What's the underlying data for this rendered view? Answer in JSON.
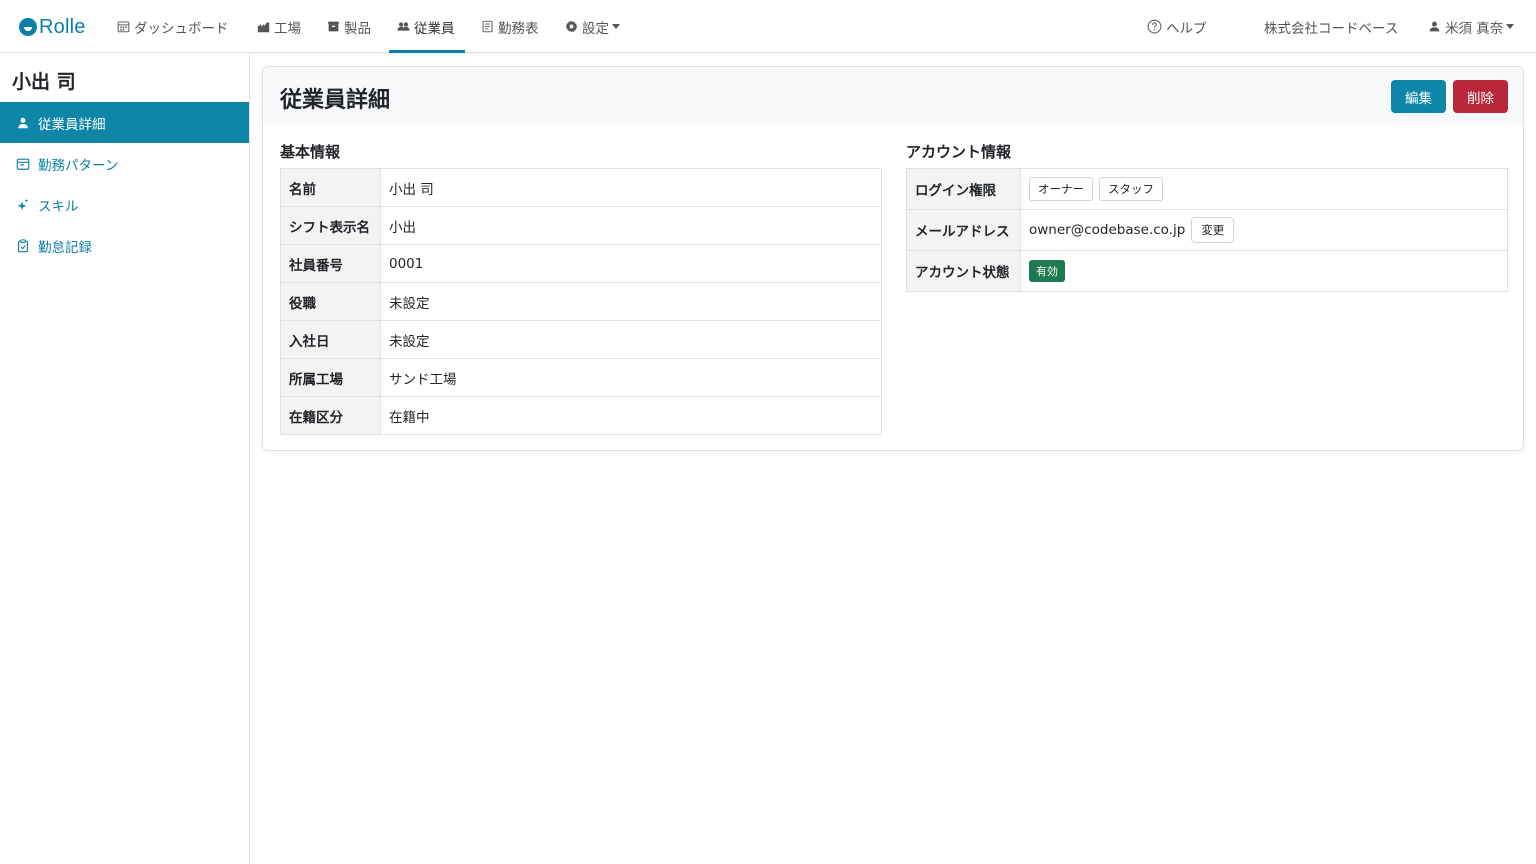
{
  "brand": {
    "name": "Rolle",
    "color": "#0d7fa6"
  },
  "nav": {
    "items": [
      {
        "label": "ダッシュボード",
        "icon": "calendar-icon"
      },
      {
        "label": "工場",
        "icon": "factory-icon"
      },
      {
        "label": "製品",
        "icon": "box-icon"
      },
      {
        "label": "従業員",
        "icon": "people-icon",
        "active": true
      },
      {
        "label": "勤務表",
        "icon": "document-icon"
      },
      {
        "label": "設定",
        "icon": "gear-icon"
      }
    ],
    "help": "ヘルプ",
    "company": "株式会社コードベース",
    "user": "米須 真奈"
  },
  "sidebar": {
    "title": "小出 司",
    "items": [
      {
        "label": "従業員詳細",
        "icon": "person-icon",
        "active": true
      },
      {
        "label": "勤務パターン",
        "icon": "calendar-icon"
      },
      {
        "label": "スキル",
        "icon": "sparkle-icon"
      },
      {
        "label": "勤怠記録",
        "icon": "clipboard-icon"
      }
    ]
  },
  "card": {
    "title": "従業員詳細",
    "edit_label": "編集",
    "delete_label": "削除"
  },
  "basic": {
    "title": "基本情報",
    "rows": [
      {
        "key": "名前",
        "value": "小出 司"
      },
      {
        "key": "シフト表示名",
        "value": "小出"
      },
      {
        "key": "社員番号",
        "value": "0001"
      },
      {
        "key": "役職",
        "value": "未設定"
      },
      {
        "key": "入社日",
        "value": "未設定"
      },
      {
        "key": "所属工場",
        "value": "サンド工場"
      },
      {
        "key": "在籍区分",
        "value": "在籍中"
      }
    ]
  },
  "account": {
    "title": "アカウント情報",
    "login_key": "ログイン権限",
    "roles": [
      "オーナー",
      "スタッフ"
    ],
    "email_key": "メールアドレス",
    "email": "owner@codebase.co.jp",
    "change_label": "変更",
    "status_key": "アカウント状態",
    "status": "有効"
  },
  "colors": {
    "primary": "#0d86a8",
    "danger": "#b8283a",
    "success": "#1b7a4f"
  }
}
